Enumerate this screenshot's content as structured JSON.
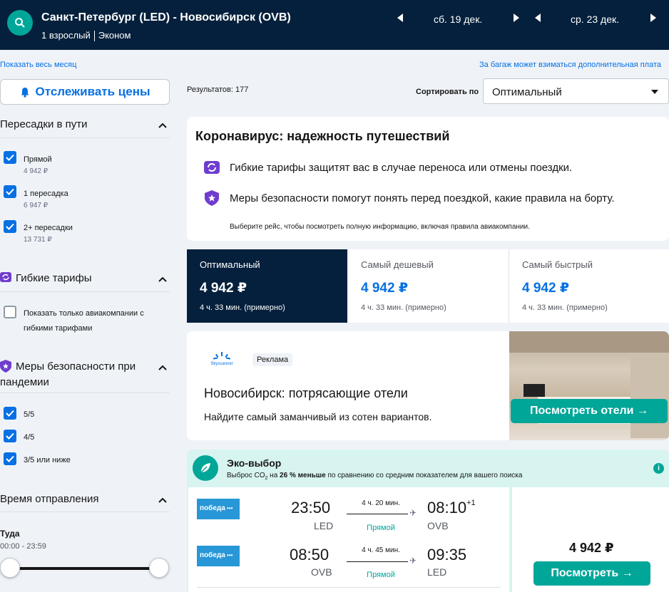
{
  "header": {
    "route": "Санкт-Петербург (LED) - Новосибирск (OVB)",
    "passengers": "1 взрослый",
    "cabin": "Эконом",
    "depart_date": "сб. 19 дек.",
    "return_date": "ср. 23 дек."
  },
  "links": {
    "show_month": "Показать весь месяц",
    "baggage_note": "За багаж может взиматься дополнительная плата"
  },
  "sidebar": {
    "track_button": "Отслеживать цены",
    "stops": {
      "title": "Пересадки в пути",
      "items": [
        {
          "label": "Прямой",
          "price": "4 942 ₽",
          "checked": true
        },
        {
          "label": "1 пересадка",
          "price": "6 947 ₽",
          "checked": true
        },
        {
          "label": "2+ пересадки",
          "price": "13 731 ₽",
          "checked": true
        }
      ]
    },
    "flexible": {
      "title": "Гибкие тарифы",
      "option_line1": "Показать только авиакомпании с",
      "option_line2": "гибкими тарифами",
      "checked": false
    },
    "safety": {
      "title_line1": "Меры безопасности при",
      "title_line2": "пандемии",
      "items": [
        {
          "label": "5/5",
          "checked": true
        },
        {
          "label": "4/5",
          "checked": true
        },
        {
          "label": "3/5 или ниже",
          "checked": true
        }
      ]
    },
    "departure": {
      "title": "Время отправления",
      "leg": "Туда",
      "range": "00:00 - 23:59"
    }
  },
  "results": {
    "count_label": "Результатов: 177",
    "sort_label": "Сортировать по",
    "sort_value": "Оптимальный"
  },
  "covid": {
    "title": "Коронавирус: надежность путешествий",
    "line1": "Гибкие тарифы защитят вас в случае переноса или отмены поездки.",
    "line2": "Меры безопасности помогут понять перед поездкой, какие правила на борту.",
    "note": "Выберите рейс, чтобы посмотреть полную информацию, включая правила авиакомпании."
  },
  "tabs": [
    {
      "name": "Оптимальный",
      "price": "4 942 ₽",
      "duration": "4 ч. 33 мин. (примерно)",
      "selected": true
    },
    {
      "name": "Самый дешевый",
      "price": "4 942 ₽",
      "duration": "4 ч. 33 мин. (примерно)",
      "selected": false
    },
    {
      "name": "Самый быстрый",
      "price": "4 942 ₽",
      "duration": "4 ч. 33 мин. (примерно)",
      "selected": false
    }
  ],
  "ad": {
    "brand": "Skyscanner",
    "badge": "Реклама",
    "headline": "Новосибирск: потрясающие отели",
    "subline": "Найдите самый заманчивый из сотен вариантов.",
    "button": "Посмотреть отели →"
  },
  "eco": {
    "title": "Эко-выбор",
    "text_before": "Выброс CO",
    "text_sub": "2",
    "text_mid": " на ",
    "text_bold": "26 % меньше",
    "text_after": " по сравнению со средним показателем для вашего поиска",
    "info": "i"
  },
  "flight": {
    "airline": "победа",
    "legs": [
      {
        "dep_time": "23:50",
        "dep_ap": "LED",
        "duration": "4 ч. 20 мин.",
        "stops": "Прямой",
        "arr_time": "08:10",
        "arr_plus": "+1",
        "arr_ap": "OVB"
      },
      {
        "dep_time": "08:50",
        "dep_ap": "OVB",
        "duration": "4 ч. 45 мин.",
        "stops": "Прямой",
        "arr_time": "09:35",
        "arr_plus": "",
        "arr_ap": "LED"
      }
    ],
    "price": "4 942 ₽",
    "button": "Посмотреть →"
  },
  "colors": {
    "navy": "#05203c",
    "teal": "#00a698",
    "blue": "#0770e3",
    "eco_bg": "#d7f4f0"
  }
}
